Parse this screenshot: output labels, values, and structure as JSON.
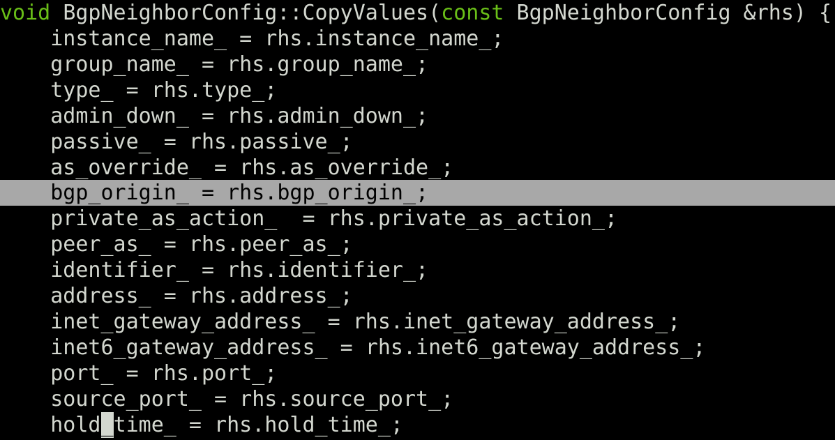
{
  "colors": {
    "background": "#000000",
    "text": "#d3d7cf",
    "keyword": "#6abf18",
    "selection_background": "#a8a8a8",
    "selection_text": "#000000",
    "cursor": "#d3d7cf"
  },
  "header": {
    "kw_void": "void",
    "name": "BgpNeighborConfig::CopyValues(",
    "kw_const": "const",
    "params": "BgpNeighborConfig &rhs) {"
  },
  "lines": [
    "    instance_name_ = rhs.instance_name_;",
    "    group_name_ = rhs.group_name_;",
    "    type_ = rhs.type_;",
    "    admin_down_ = rhs.admin_down_;",
    "    passive_ = rhs.passive_;",
    "    as_override_ = rhs.as_override_;",
    "    bgp_origin_ = rhs.bgp_origin_;",
    "    private_as_action_  = rhs.private_as_action_;",
    "    peer_as_ = rhs.peer_as_;",
    "    identifier_ = rhs.identifier_;",
    "    address_ = rhs.address_;",
    "    inet_gateway_address_ = rhs.inet_gateway_address_;",
    "    inet6_gateway_address_ = rhs.inet6_gateway_address_;",
    "    port_ = rhs.port_;",
    "    source_port_ = rhs.source_port_;"
  ],
  "cursor_line": {
    "before": "    hold",
    "cursor_char": "_",
    "after": "time_ = rhs.hold_time_;"
  }
}
